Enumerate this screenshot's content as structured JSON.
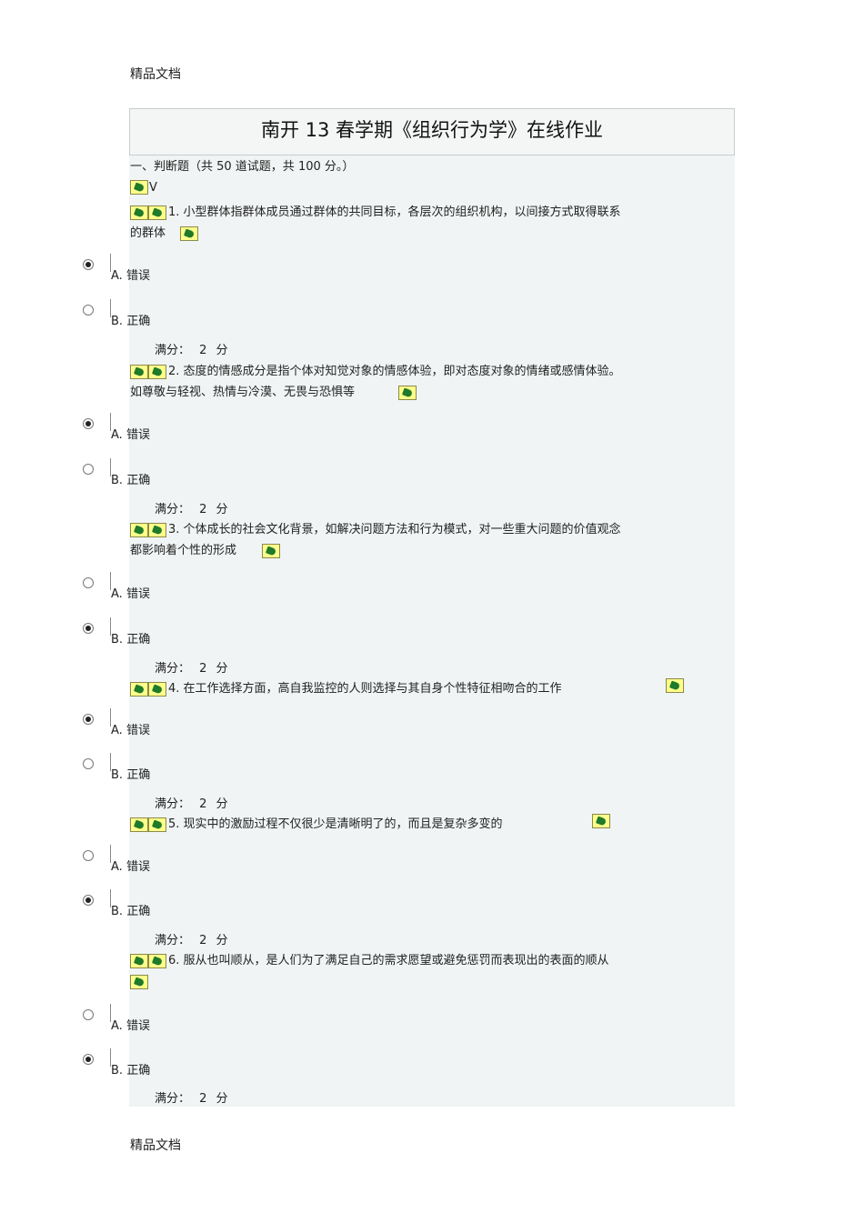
{
  "watermark": "精品文档",
  "title": "南开 13 春学期《组织行为学》在线作业",
  "section_heading": "一、判断题（共 50 道试题，共 100 分。）",
  "v_label": "V",
  "questions": [
    {
      "number": "1.",
      "text": "小型群体指群体成员通过群体的目标，各层次的组织机构，以间接方式取得联系的群体",
      "line1": "小型群体指群体成员通过群体的共同目标，各层次的组织机构，以间接方式取得联系",
      "line2": "的群体",
      "options": [
        {
          "letter": "A.",
          "label": "错误",
          "selected": true
        },
        {
          "letter": "B.",
          "label": "正确",
          "selected": false
        }
      ],
      "score": "满分： 2 分"
    },
    {
      "number": "2.",
      "line1": "态度的情感成分是指个体对知觉对象的情感体验，即对态度对象的情绪或感情体验。",
      "line2": "如尊敬与轻视、热情与冷漠、无畏与恐惧等",
      "options": [
        {
          "letter": "A.",
          "label": "错误",
          "selected": true
        },
        {
          "letter": "B.",
          "label": "正确",
          "selected": false
        }
      ],
      "score": "满分： 2 分"
    },
    {
      "number": "3.",
      "line1": "个体成长的社会文化背景，如解决问题方法和行为模式，对一些重大问题的价值观念",
      "line2": "都影响着个性的形成",
      "options": [
        {
          "letter": "A.",
          "label": "错误",
          "selected": false
        },
        {
          "letter": "B.",
          "label": "正确",
          "selected": true
        }
      ],
      "score": "满分： 2 分"
    },
    {
      "number": "4.",
      "line1": "在工作选择方面，高自我监控的人则选择与其自身个性特征相吻合的工作",
      "line2": "",
      "options": [
        {
          "letter": "A.",
          "label": "错误",
          "selected": true
        },
        {
          "letter": "B.",
          "label": "正确",
          "selected": false
        }
      ],
      "score": "满分： 2 分"
    },
    {
      "number": "5.",
      "line1": "现实中的激励过程不仅很少是清晰明了的，而且是复杂多变的",
      "line2": "",
      "options": [
        {
          "letter": "A.",
          "label": "错误",
          "selected": false
        },
        {
          "letter": "B.",
          "label": "正确",
          "selected": true
        }
      ],
      "score": "满分： 2 分"
    },
    {
      "number": "6.",
      "line1": "服从也叫顺从，是人们为了满足自己的需求愿望或避免惩罚而表现出的表面的顺从",
      "line2": "",
      "options": [
        {
          "letter": "A.",
          "label": "错误",
          "selected": false
        },
        {
          "letter": "B.",
          "label": "正确",
          "selected": true
        }
      ],
      "score": "满分： 2 分"
    }
  ]
}
